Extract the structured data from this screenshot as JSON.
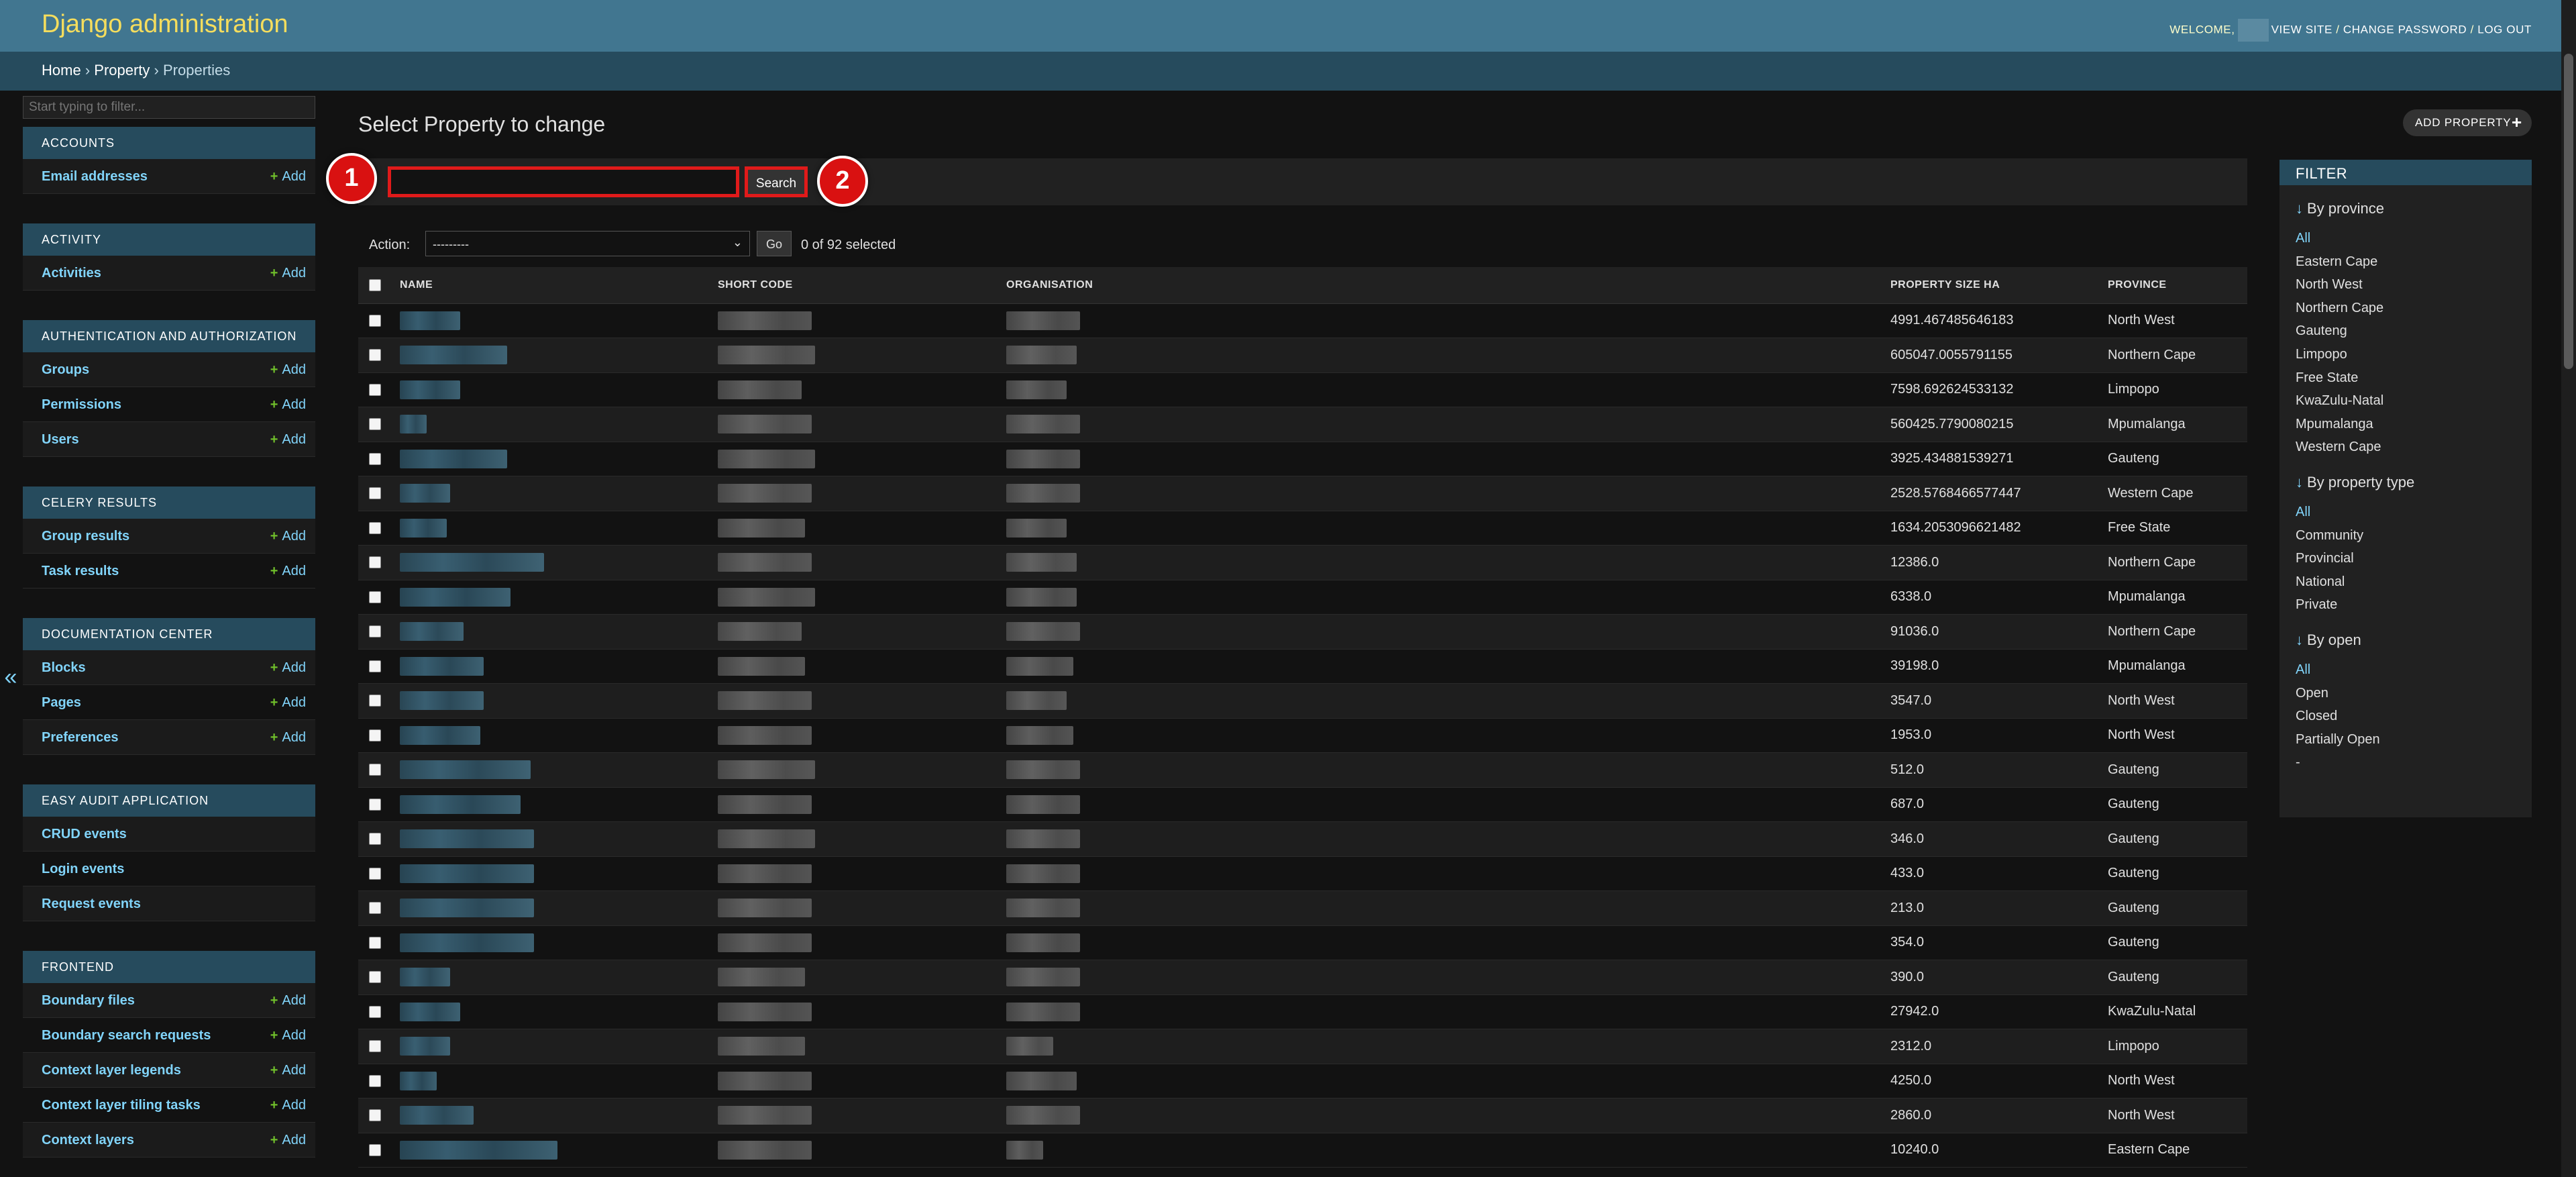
{
  "header": {
    "site_name": "Django administration",
    "welcome": "WELCOME,",
    "view_site": "VIEW SITE",
    "sep": "/",
    "change_password": "CHANGE PASSWORD",
    "log_out": "LOG OUT"
  },
  "breadcrumbs": {
    "home": "Home",
    "app": "Property",
    "current": "Properties",
    "sep": "›"
  },
  "sidebar": {
    "filter_placeholder": "Start typing to filter...",
    "collapse_glyph": "«",
    "add_label": "Add",
    "add_plus": "+",
    "modules": [
      {
        "caption": "ACCOUNTS",
        "models": [
          {
            "name": "Email addresses",
            "add": true
          }
        ]
      },
      {
        "caption": "ACTIVITY",
        "models": [
          {
            "name": "Activities",
            "add": true
          }
        ]
      },
      {
        "caption": "AUTHENTICATION AND AUTHORIZATION",
        "models": [
          {
            "name": "Groups",
            "add": true
          },
          {
            "name": "Permissions",
            "add": true
          },
          {
            "name": "Users",
            "add": true
          }
        ]
      },
      {
        "caption": "CELERY RESULTS",
        "models": [
          {
            "name": "Group results",
            "add": true
          },
          {
            "name": "Task results",
            "add": true
          }
        ]
      },
      {
        "caption": "DOCUMENTATION CENTER",
        "models": [
          {
            "name": "Blocks",
            "add": true
          },
          {
            "name": "Pages",
            "add": true
          },
          {
            "name": "Preferences",
            "add": true
          }
        ]
      },
      {
        "caption": "EASY AUDIT APPLICATION",
        "models": [
          {
            "name": "CRUD events",
            "add": false
          },
          {
            "name": "Login events",
            "add": false
          },
          {
            "name": "Request events",
            "add": false
          }
        ]
      },
      {
        "caption": "FRONTEND",
        "models": [
          {
            "name": "Boundary files",
            "add": true
          },
          {
            "name": "Boundary search requests",
            "add": true
          },
          {
            "name": "Context layer legends",
            "add": true
          },
          {
            "name": "Context layer tiling tasks",
            "add": true
          },
          {
            "name": "Context layers",
            "add": true
          }
        ]
      }
    ]
  },
  "content": {
    "title": "Select Property to change",
    "add_button": "ADD PROPERTY",
    "add_icon": "+",
    "search_button": "Search",
    "search_value": "",
    "markers": [
      "1",
      "2"
    ],
    "action_label": "Action:",
    "action_selected": "---------",
    "action_chevron": "⌄",
    "go_button": "Go",
    "action_counter": "0 of 92 selected"
  },
  "table": {
    "columns": [
      "NAME",
      "SHORT CODE",
      "ORGANISATION",
      "PROPERTY SIZE HA",
      "PROVINCE"
    ],
    "rows": [
      {
        "size": "4991.467485646183",
        "province": "North West",
        "nw": 90,
        "cw": 140,
        "ow": 110
      },
      {
        "size": "605047.0055791155",
        "province": "Northern Cape",
        "nw": 160,
        "cw": 145,
        "ow": 105
      },
      {
        "size": "7598.692624533132",
        "province": "Limpopo",
        "nw": 90,
        "cw": 125,
        "ow": 90
      },
      {
        "size": "560425.7790080215",
        "province": "Mpumalanga",
        "nw": 40,
        "cw": 140,
        "ow": 110
      },
      {
        "size": "3925.434881539271",
        "province": "Gauteng",
        "nw": 160,
        "cw": 145,
        "ow": 110
      },
      {
        "size": "2528.5768466577447",
        "province": "Western Cape",
        "nw": 75,
        "cw": 140,
        "ow": 110
      },
      {
        "size": "1634.2053096621482",
        "province": "Free State",
        "nw": 70,
        "cw": 130,
        "ow": 90
      },
      {
        "size": "12386.0",
        "province": "Northern Cape",
        "nw": 215,
        "cw": 140,
        "ow": 105
      },
      {
        "size": "6338.0",
        "province": "Mpumalanga",
        "nw": 165,
        "cw": 145,
        "ow": 105
      },
      {
        "size": "91036.0",
        "province": "Northern Cape",
        "nw": 95,
        "cw": 125,
        "ow": 110
      },
      {
        "size": "39198.0",
        "province": "Mpumalanga",
        "nw": 125,
        "cw": 130,
        "ow": 100
      },
      {
        "size": "3547.0",
        "province": "North West",
        "nw": 125,
        "cw": 140,
        "ow": 90
      },
      {
        "size": "1953.0",
        "province": "North West",
        "nw": 120,
        "cw": 140,
        "ow": 100
      },
      {
        "size": "512.0",
        "province": "Gauteng",
        "nw": 195,
        "cw": 145,
        "ow": 110
      },
      {
        "size": "687.0",
        "province": "Gauteng",
        "nw": 180,
        "cw": 140,
        "ow": 110
      },
      {
        "size": "346.0",
        "province": "Gauteng",
        "nw": 200,
        "cw": 145,
        "ow": 110
      },
      {
        "size": "433.0",
        "province": "Gauteng",
        "nw": 200,
        "cw": 140,
        "ow": 110
      },
      {
        "size": "213.0",
        "province": "Gauteng",
        "nw": 200,
        "cw": 140,
        "ow": 110
      },
      {
        "size": "354.0",
        "province": "Gauteng",
        "nw": 200,
        "cw": 140,
        "ow": 110
      },
      {
        "size": "390.0",
        "province": "Gauteng",
        "nw": 75,
        "cw": 130,
        "ow": 110
      },
      {
        "size": "27942.0",
        "province": "KwaZulu-Natal",
        "nw": 90,
        "cw": 140,
        "ow": 110
      },
      {
        "size": "2312.0",
        "province": "Limpopo",
        "nw": 75,
        "cw": 130,
        "ow": 70
      },
      {
        "size": "4250.0",
        "province": "North West",
        "nw": 55,
        "cw": 140,
        "ow": 105
      },
      {
        "size": "2860.0",
        "province": "North West",
        "nw": 110,
        "cw": 140,
        "ow": 110
      },
      {
        "size": "10240.0",
        "province": "Eastern Cape",
        "nw": 235,
        "cw": 140,
        "ow": 55
      }
    ]
  },
  "filter": {
    "header": "FILTER",
    "arrow": "↓",
    "groups": [
      {
        "title": "By province",
        "options": [
          "All",
          "Eastern Cape",
          "North West",
          "Northern Cape",
          "Gauteng",
          "Limpopo",
          "Free State",
          "KwaZulu-Natal",
          "Mpumalanga",
          "Western Cape"
        ]
      },
      {
        "title": "By property type",
        "options": [
          "All",
          "Community",
          "Provincial",
          "National",
          "Private"
        ]
      },
      {
        "title": "By open",
        "options": [
          "All",
          "Open",
          "Closed",
          "Partially Open",
          "-"
        ]
      }
    ]
  },
  "colors": {
    "header_bg": "#417690",
    "breadcrumb_bg": "#264b5d",
    "brand_yellow": "#f5dd5d",
    "link_blue": "#81d4fa",
    "add_green": "#70bf2b",
    "annotation_red": "#e01a1a"
  }
}
